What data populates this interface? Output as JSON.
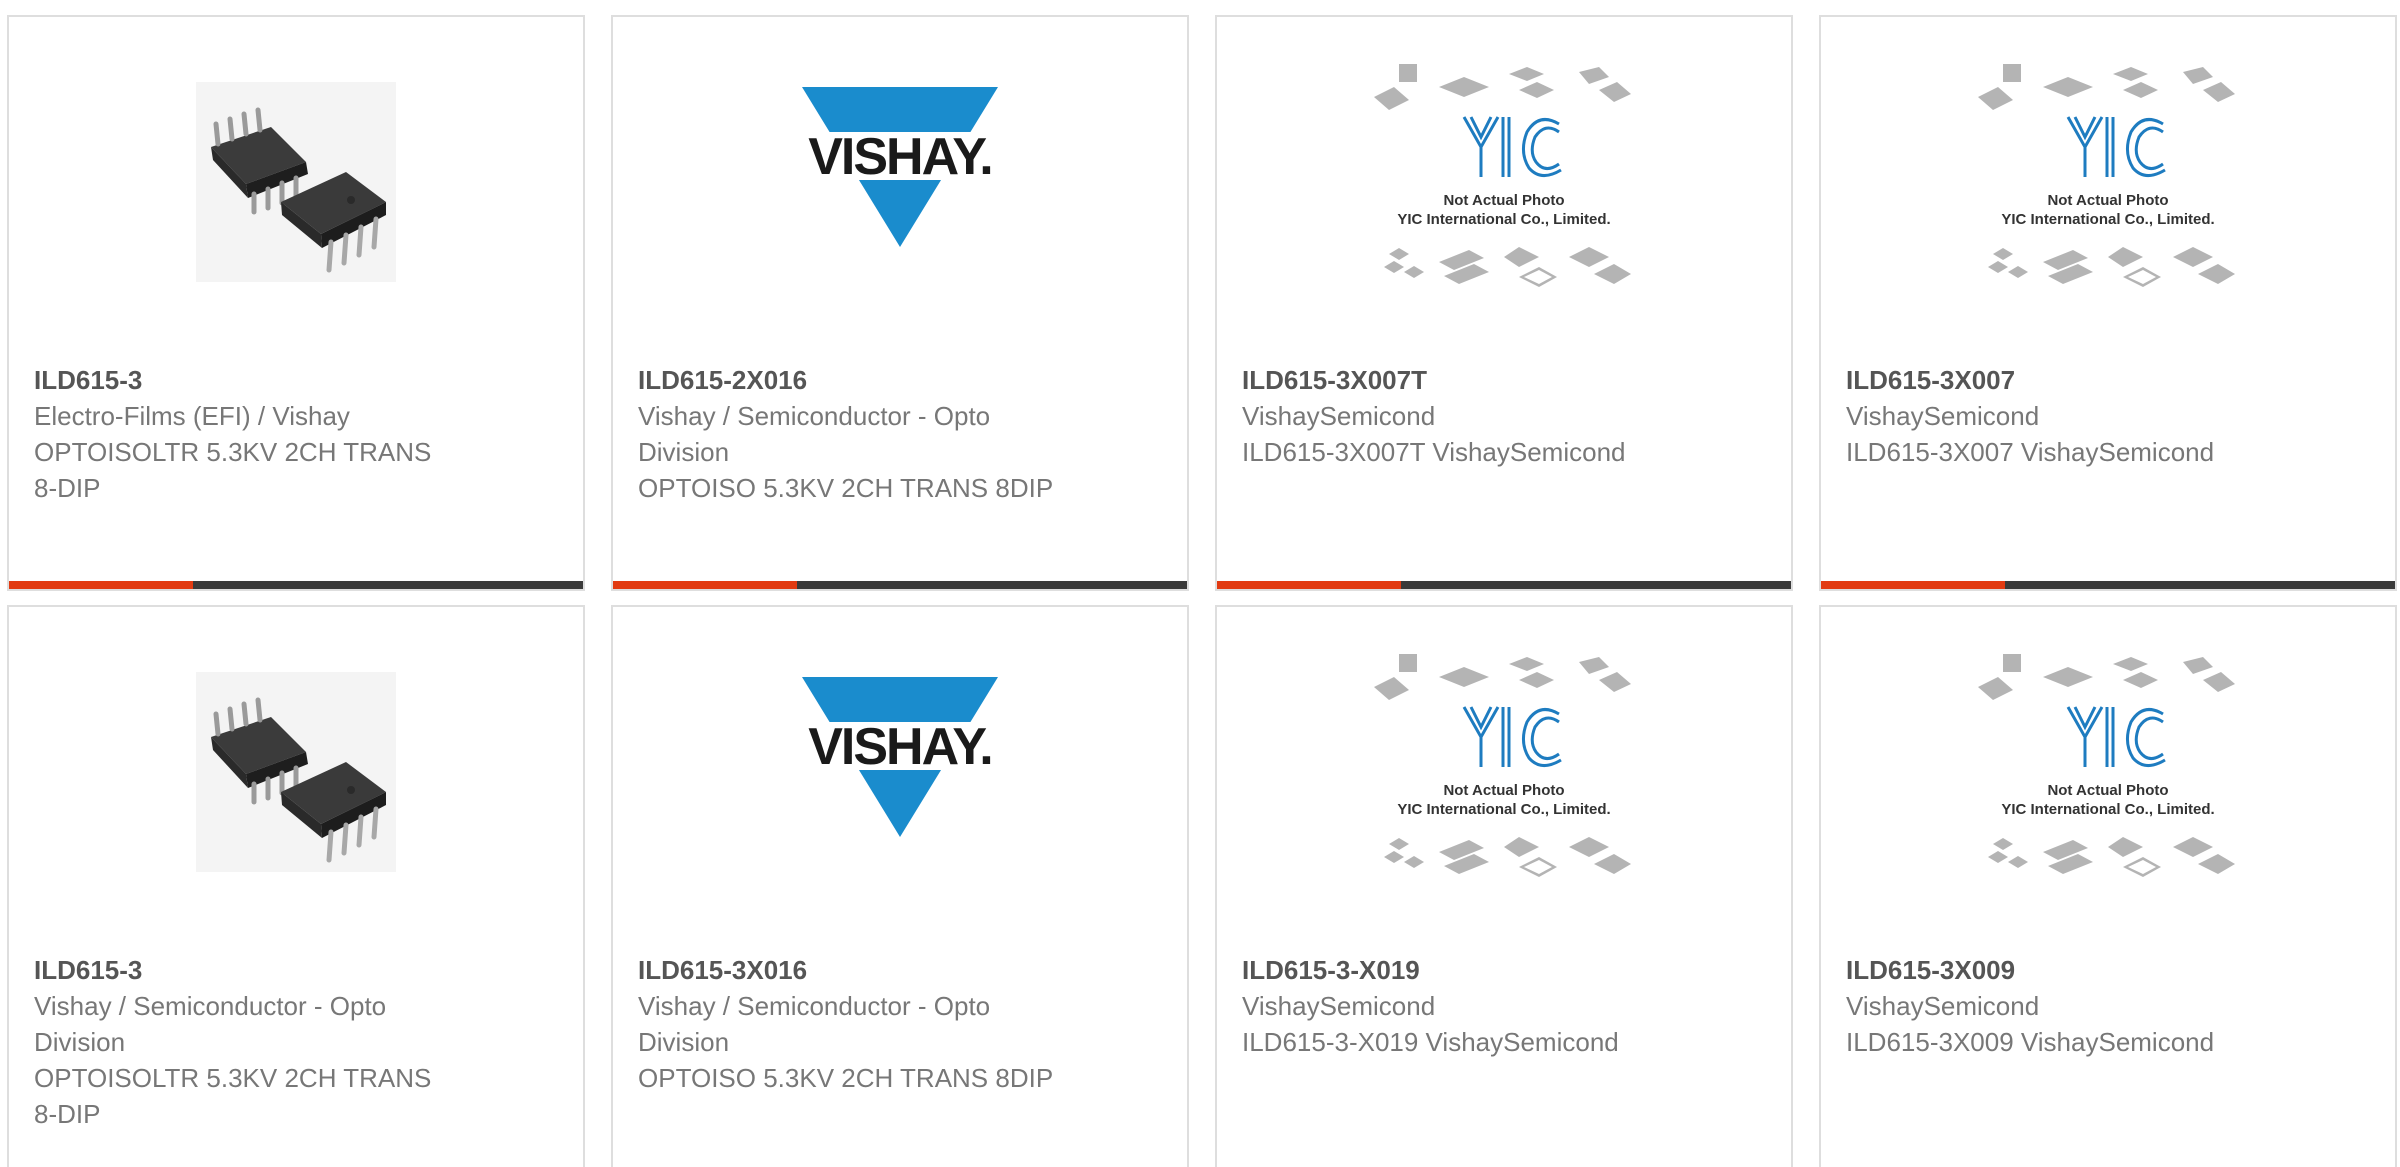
{
  "colors": {
    "accent": "#e23b12",
    "bar": "#3a3a3a",
    "border": "#dedede",
    "vishay_blue": "#1a8ccd"
  },
  "cards": [
    {
      "part_number": "ILD615-3",
      "manufacturer": "Electro-Films (EFI) / Vishay",
      "description": "OPTOISOLTR 5.3KV 2CH TRANS 8-DIP",
      "image": "dip-chip-photo"
    },
    {
      "part_number": "ILD615-2X016",
      "manufacturer": "Vishay / Semiconductor - Opto Division",
      "description": "OPTOISO 5.3KV 2CH TRANS 8DIP",
      "image": "vishay-logo",
      "logo_text": "VISHAY."
    },
    {
      "part_number": "ILD615-3X007T",
      "manufacturer": "VishaySemicond",
      "description": "ILD615-3X007T VishaySemicond",
      "image": "yic-placeholder",
      "placeholder_line1": "Not Actual Photo",
      "placeholder_line2": "YIC International Co., Limited.",
      "placeholder_logo": "YIC"
    },
    {
      "part_number": "ILD615-3X007",
      "manufacturer": "VishaySemicond",
      "description": "ILD615-3X007 VishaySemicond",
      "image": "yic-placeholder",
      "placeholder_line1": "Not Actual Photo",
      "placeholder_line2": "YIC International Co., Limited.",
      "placeholder_logo": "YIC"
    },
    {
      "part_number": "ILD615-3",
      "manufacturer": "Vishay / Semiconductor - Opto Division",
      "description": "OPTOISOLTR 5.3KV 2CH TRANS 8-DIP",
      "image": "dip-chip-photo"
    },
    {
      "part_number": "ILD615-3X016",
      "manufacturer": "Vishay / Semiconductor - Opto Division",
      "description": "OPTOISO 5.3KV 2CH TRANS 8DIP",
      "image": "vishay-logo",
      "logo_text": "VISHAY."
    },
    {
      "part_number": "ILD615-3-X019",
      "manufacturer": "VishaySemicond",
      "description": "ILD615-3-X019 VishaySemicond",
      "image": "yic-placeholder",
      "placeholder_line1": "Not Actual Photo",
      "placeholder_line2": "YIC International Co., Limited.",
      "placeholder_logo": "YIC"
    },
    {
      "part_number": "ILD615-3X009",
      "manufacturer": "VishaySemicond",
      "description": "ILD615-3X009 VishaySemicond",
      "image": "yic-placeholder",
      "placeholder_line1": "Not Actual Photo",
      "placeholder_line2": "YIC International Co., Limited.",
      "placeholder_logo": "YIC"
    }
  ]
}
